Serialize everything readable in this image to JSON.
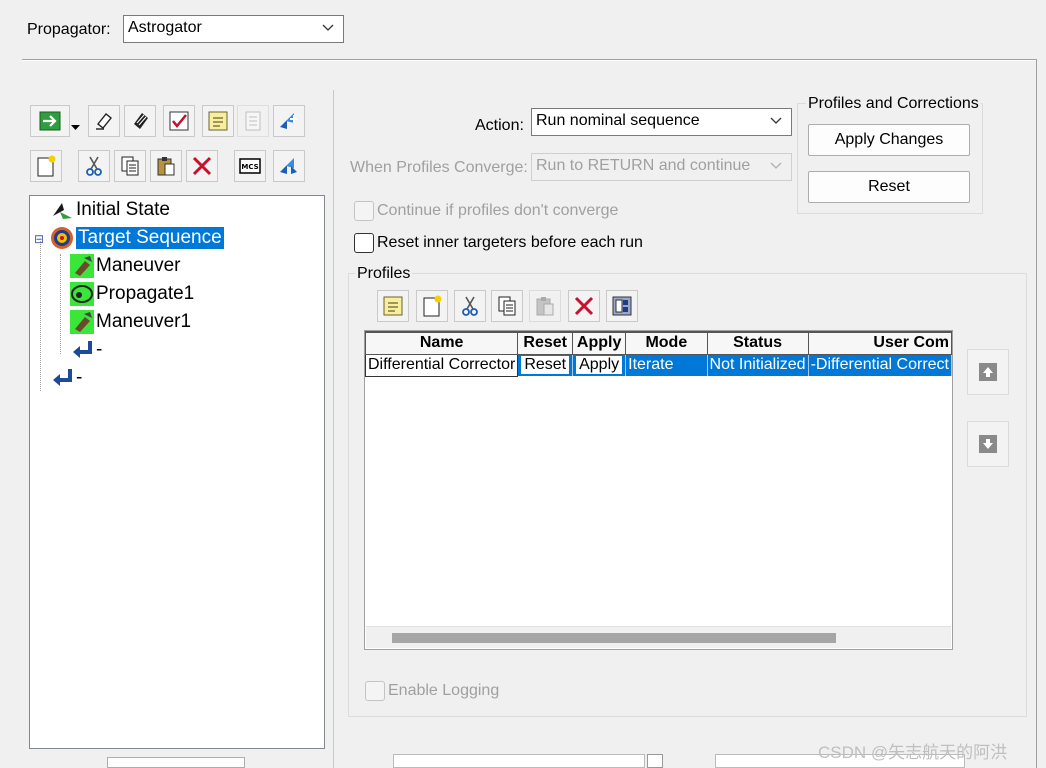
{
  "propagator": {
    "label": "Propagator:",
    "value": "Astrogator"
  },
  "toolbar_mcs": {
    "row1": [
      "run-green-arrow-icon",
      "dropdown-caret-icon",
      "eraser-icon",
      "stripe-eraser-icon",
      "checklist-icon",
      "notes-icon",
      "summary-icon",
      "insert-segment-icon"
    ],
    "row2": [
      "new-icon",
      "cut-icon",
      "copy-icon",
      "paste-icon",
      "delete-icon",
      "mcs-icon",
      "segment-flow-icon"
    ]
  },
  "tree": {
    "items": [
      {
        "label": "Initial State",
        "icon": "initial-state-icon"
      },
      {
        "label": "Target Sequence",
        "icon": "target-sequence-icon",
        "expander": "⊟"
      },
      {
        "label": "Maneuver",
        "icon": "maneuver-icon"
      },
      {
        "label": "Propagate1",
        "icon": "propagate-icon"
      },
      {
        "label": "Maneuver1",
        "icon": "maneuver-icon"
      },
      {
        "label": "-",
        "icon": "return-icon"
      },
      {
        "label": "-",
        "icon": "return-icon"
      }
    ]
  },
  "action": {
    "label": "Action:",
    "value": "Run nominal sequence"
  },
  "when_converge": {
    "label": "When Profiles Converge:",
    "value": "Run to RETURN and continue"
  },
  "continue_check": {
    "label": "Continue if profiles don't converge",
    "checked": false
  },
  "reset_inner_check": {
    "label": "Reset inner targeters before each run",
    "checked": false
  },
  "profiles_corrections": {
    "title": "Profiles and Corrections",
    "apply_label": "Apply Changes",
    "reset_label": "Reset"
  },
  "profiles": {
    "title": "Profiles",
    "toolbar": [
      "notes-icon",
      "new-icon",
      "cut-icon",
      "copy-icon",
      "paste-icon",
      "delete-icon",
      "properties-icon"
    ],
    "columns": [
      "Name",
      "Reset",
      "Apply",
      "Mode",
      "Status",
      "User Com"
    ],
    "rows": [
      {
        "name": "Differential Corrector",
        "reset": "Reset",
        "apply": "Apply",
        "mode": "Iterate",
        "status": "Not Initialized",
        "comment": "-Differential Correct"
      }
    ]
  },
  "enable_logging": {
    "label": "Enable Logging",
    "checked": false
  },
  "watermark": "CSDN @矢志航天的阿洪",
  "colors": {
    "selection": "#0078d7",
    "background": "#f0f0f0"
  }
}
